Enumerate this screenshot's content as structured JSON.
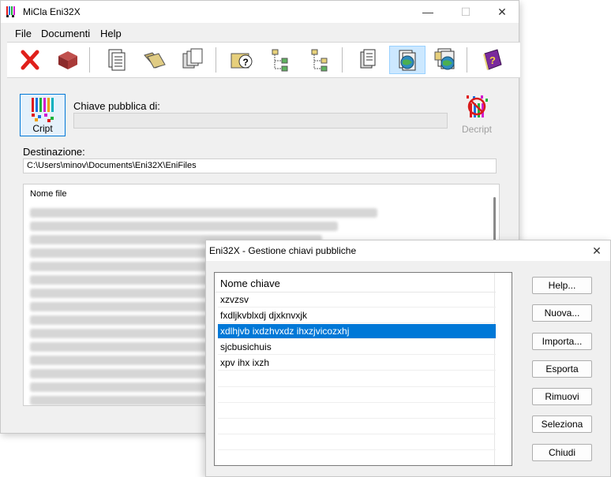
{
  "main_window": {
    "title": "MiCla Eni32X",
    "controls": {
      "minimize": "—",
      "maximize": "☐",
      "close": "✕"
    },
    "menu": [
      "File",
      "Documenti",
      "Help"
    ],
    "toolbar_icons": [
      "delete-icon",
      "package-icon",
      "documents-list-icon",
      "open-folder-icon",
      "copy-documents-icon",
      "help-folder-icon",
      "tree-branch-icon",
      "tree-branch-2-icon",
      "document-stack-icon",
      "globe-document-icon",
      "globe-documents-icon",
      "help-book-icon"
    ],
    "cript_label": "Cript",
    "decript_label": "Decript",
    "chiave_label": "Chiave pubblica di:",
    "chiave_value": "",
    "destinazione_label": "Destinazione:",
    "destinazione_value": "C:\\Users\\minov\\Documents\\Eni32X\\EniFiles",
    "file_list_header": "Nome file"
  },
  "dialog": {
    "title": "Eni32X - Gestione chiavi pubbliche",
    "close": "✕",
    "list_header": "Nome chiave",
    "keys": [
      "xzvzsv",
      "fxdljkvblxdj djxknvxjk",
      "xdlhjvb ixdzhvxdz ihxzjvicozxhj",
      "sjcbusichuis",
      "xpv ihx ixzh"
    ],
    "selected_key": "xdlhjvb ixdzhvxdz ihxzjvicozxhj",
    "buttons": {
      "help": "Help...",
      "nuova": "Nuova...",
      "importa": "Importa...",
      "esporta": "Esporta",
      "rimuovi": "Rimuovi",
      "seleziona": "Seleziona",
      "chiudi": "Chiudi"
    }
  },
  "colors": {
    "selection": "#0078d7",
    "window_bg": "#f0f0f0"
  }
}
